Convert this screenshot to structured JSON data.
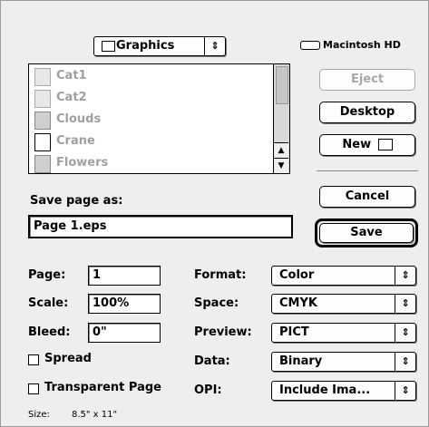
{
  "folder_popup": {
    "label": "Graphics",
    "icon": "folder-icon"
  },
  "disk": {
    "label": "Macintosh HD",
    "icon": "hard-disk-icon"
  },
  "file_list": [
    {
      "name": "Cat1",
      "icon": "picture-file-icon"
    },
    {
      "name": "Cat2",
      "icon": "picture-file-icon"
    },
    {
      "name": "Clouds",
      "icon": "picture-file-icon"
    },
    {
      "name": "Crane",
      "icon": "document-icon"
    },
    {
      "name": "Flowers",
      "icon": "picture-file-icon"
    }
  ],
  "buttons": {
    "eject": "Eject",
    "desktop": "Desktop",
    "new": "New",
    "cancel": "Cancel",
    "save": "Save"
  },
  "save_as": {
    "label": "Save page as:",
    "value": "Page 1.eps"
  },
  "options": {
    "page_label": "Page:",
    "page_value": "1",
    "scale_label": "Scale:",
    "scale_value": "100%",
    "bleed_label": "Bleed:",
    "bleed_value": "0\"",
    "spread_label": "Spread",
    "transparent_label": "Transparent Page",
    "format_label": "Format:",
    "format_value": "Color",
    "space_label": "Space:",
    "space_value": "CMYK",
    "preview_label": "Preview:",
    "preview_value": "PICT",
    "data_label": "Data:",
    "data_value": "Binary",
    "opi_label": "OPI:",
    "opi_value": "Include Ima..."
  },
  "size": {
    "label": "Size:",
    "value": "8.5\" x 11\""
  }
}
